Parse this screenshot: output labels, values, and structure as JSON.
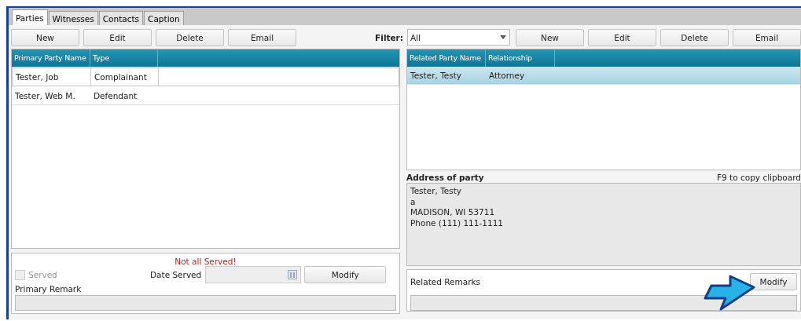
{
  "tabs": [
    {
      "label": "Parties",
      "selected": true
    },
    {
      "label": "Witnesses",
      "selected": false
    },
    {
      "label": "Contacts",
      "selected": false
    },
    {
      "label": "Caption",
      "selected": false
    }
  ],
  "left_toolbar": [
    "New",
    "Edit",
    "Delete",
    "Email"
  ],
  "filter": {
    "label": "Filter:",
    "value": "All"
  },
  "right_toolbar": [
    "New",
    "Edit",
    "Delete",
    "Email"
  ],
  "primary_table": {
    "columns": [
      "Primary Party Name",
      "Type"
    ],
    "rows": [
      {
        "cells": [
          "Tester, Job",
          "Complainant"
        ],
        "selected": true
      },
      {
        "cells": [
          "Tester, Web M.",
          "Defendant"
        ],
        "selected": false
      }
    ]
  },
  "related_table": {
    "columns": [
      "Related Party Name",
      "Relationship"
    ],
    "rows": [
      {
        "cells": [
          "Tester, Testy",
          "Attorney"
        ],
        "selected": true
      }
    ]
  },
  "served_panel": {
    "warning": "Not all Served!",
    "served": {
      "label": "Served",
      "checked": false,
      "disabled": true
    },
    "date_label": "Date Served",
    "modify": "Modify",
    "remark_label": "Primary Remark"
  },
  "address": {
    "title": "Address of party",
    "hint": "F9 to copy clipboard",
    "lines": [
      "Tester, Testy",
      "a",
      "MADISON, WI 53711",
      "Phone (111) 111-1111"
    ]
  },
  "related_remarks": {
    "label": "Related Remarks",
    "modify": "Modify"
  }
}
